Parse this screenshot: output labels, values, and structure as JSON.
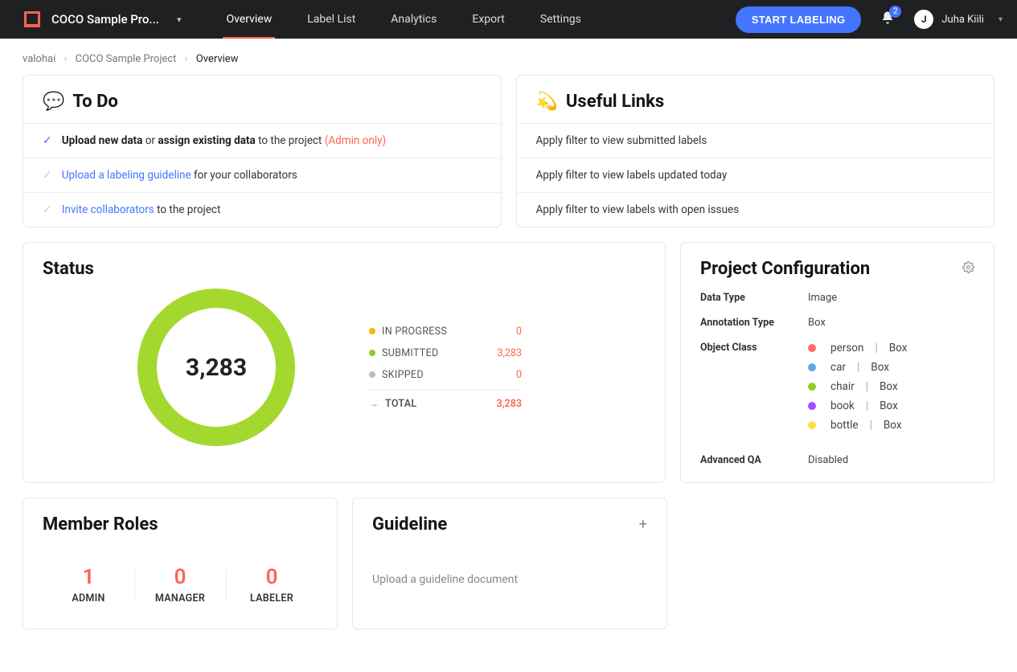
{
  "header": {
    "project_name": "COCO Sample Pro...",
    "tabs": [
      "Overview",
      "Label List",
      "Analytics",
      "Export",
      "Settings"
    ],
    "active_tab": 0,
    "start_label": "START LABELING",
    "notif_count": "2",
    "user_initial": "J",
    "user_name": "Juha Kiili"
  },
  "breadcrumb": {
    "org": "valohai",
    "project": "COCO Sample Project",
    "page": "Overview"
  },
  "todo": {
    "title": "To Do",
    "emoji": "💬",
    "items": [
      {
        "check": true,
        "html": [
          "b:Upload new data",
          " or ",
          "b:assign existing data",
          " to the project ",
          "admin:(Admin only)"
        ]
      },
      {
        "check": false,
        "html": [
          "lnk:Upload a labeling guideline",
          " for your collaborators"
        ]
      },
      {
        "check": false,
        "html": [
          "lnk:Invite collaborators",
          " to the project"
        ]
      }
    ]
  },
  "links": {
    "title": "Useful Links",
    "emoji": "💫",
    "items": [
      "Apply filter to view submitted labels",
      "Apply filter to view labels updated today",
      "Apply filter to view labels with open issues"
    ]
  },
  "status": {
    "title": "Status",
    "center": "3,283",
    "rows": [
      {
        "color": "#f5b80f",
        "label": "IN PROGRESS",
        "value": "0"
      },
      {
        "color": "#8ecf23",
        "label": "SUBMITTED",
        "value": "3,283"
      },
      {
        "color": "#bdbdbd",
        "label": "SKIPPED",
        "value": "0"
      }
    ],
    "total_label": "TOTAL",
    "total_value": "3,283"
  },
  "config": {
    "title": "Project Configuration",
    "data_type_k": "Data Type",
    "data_type_v": "Image",
    "anno_type_k": "Annotation Type",
    "anno_type_v": "Box",
    "obj_class_k": "Object Class",
    "classes": [
      {
        "color": "#ff6b6b",
        "name": "person",
        "type": "Box"
      },
      {
        "color": "#5fa8e8",
        "name": "car",
        "type": "Box"
      },
      {
        "color": "#8ecf23",
        "name": "chair",
        "type": "Box"
      },
      {
        "color": "#a24dff",
        "name": "book",
        "type": "Box"
      },
      {
        "color": "#ffe13b",
        "name": "bottle",
        "type": "Box"
      }
    ],
    "adv_k": "Advanced QA",
    "adv_v": "Disabled"
  },
  "members": {
    "title": "Member Roles",
    "roles": [
      {
        "count": "1",
        "label": "ADMIN"
      },
      {
        "count": "0",
        "label": "MANAGER"
      },
      {
        "count": "0",
        "label": "LABELER"
      }
    ]
  },
  "guideline": {
    "title": "Guideline",
    "text": "Upload a guideline document"
  }
}
